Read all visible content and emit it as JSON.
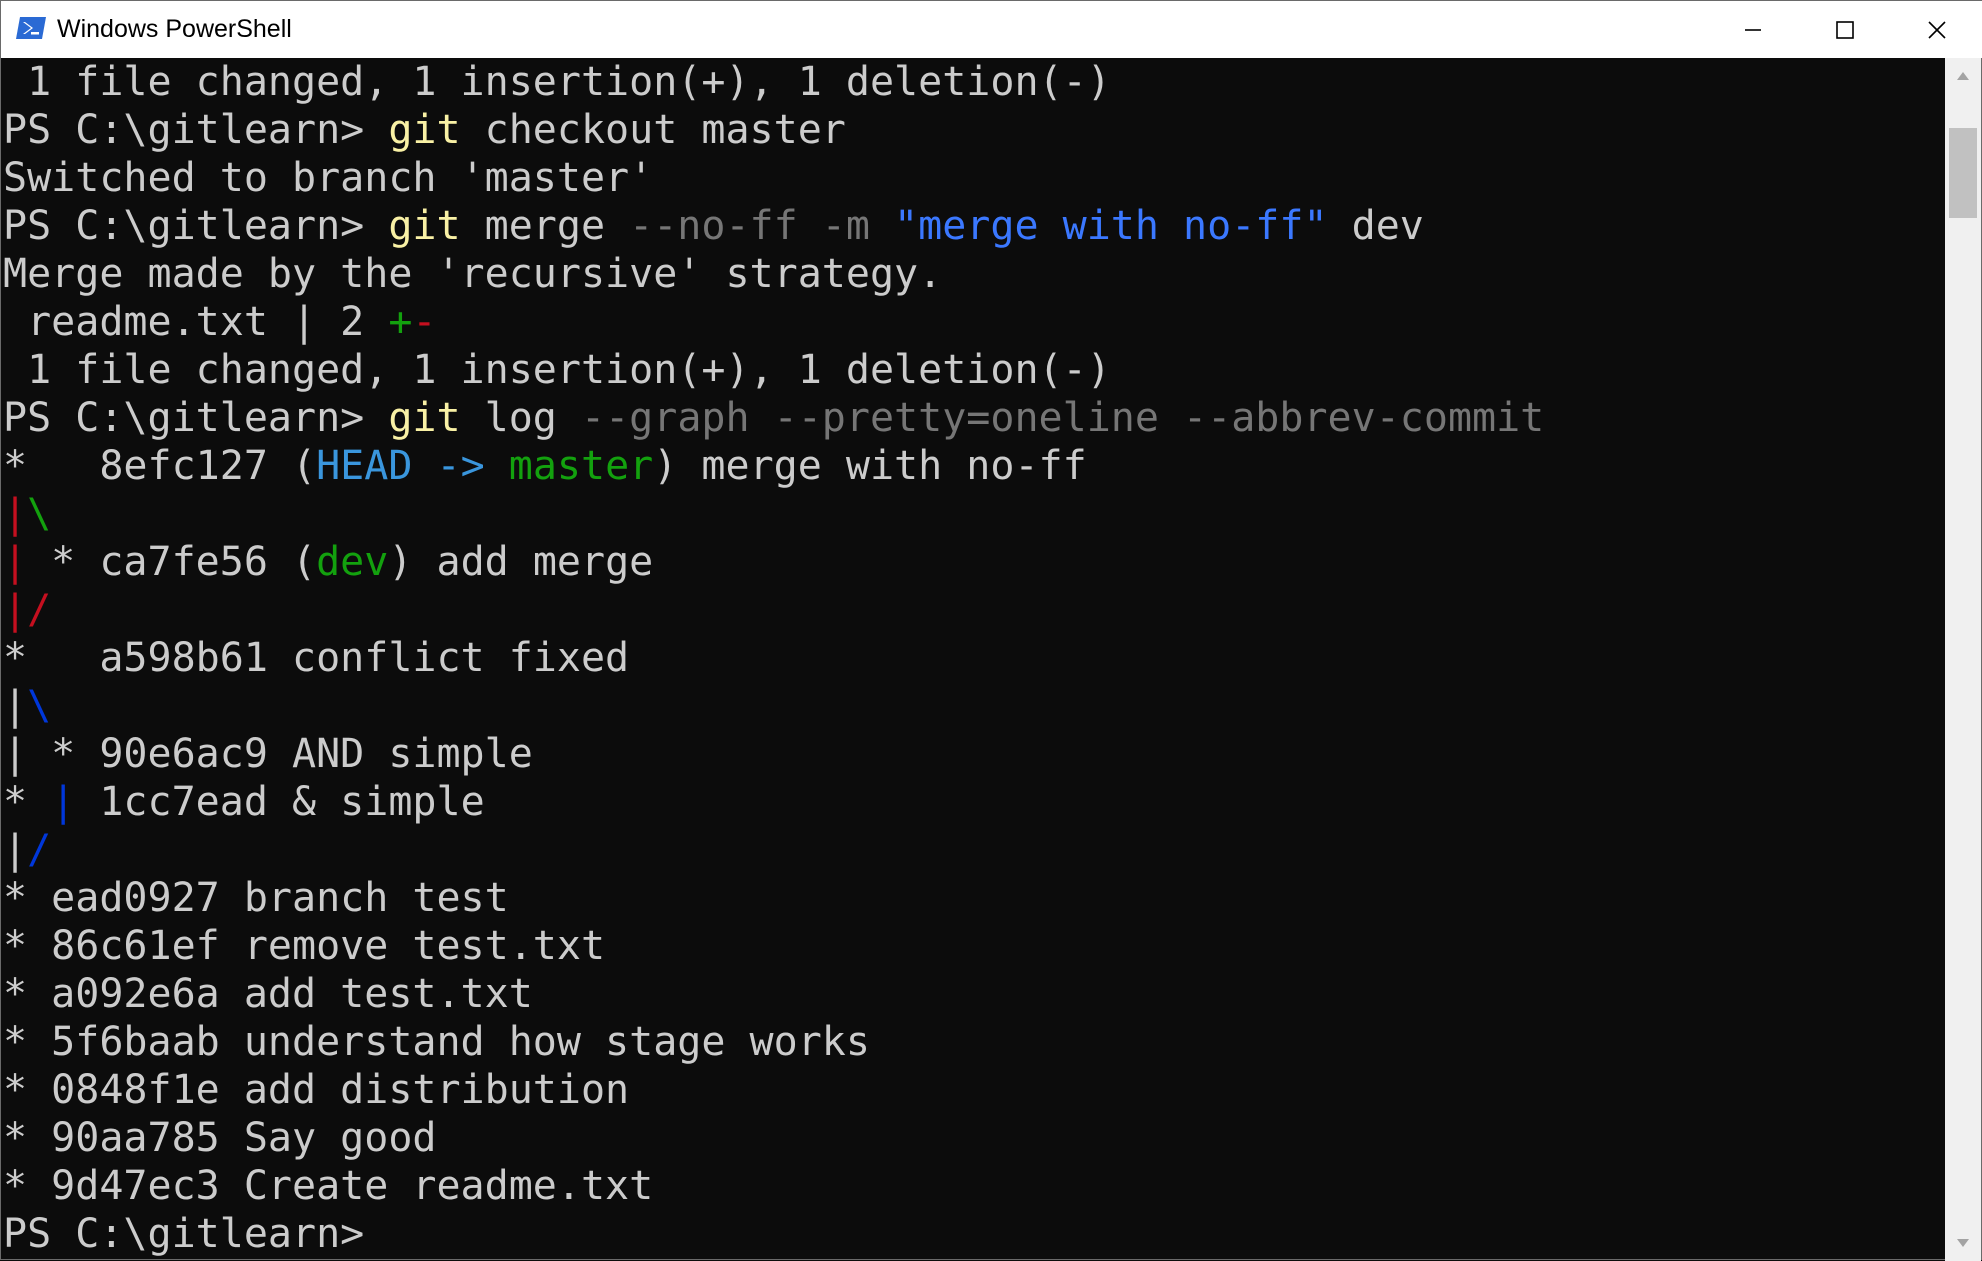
{
  "window": {
    "title": "Windows PowerShell"
  },
  "colors": {
    "default": "#cccccc",
    "cmd": "#f9f1a5",
    "param": "#767676",
    "string": "#3b78ff",
    "green": "#13a10e",
    "cyan": "#3a96dd",
    "red": "#c50f1f",
    "blue": "#0037da"
  },
  "lines": [
    [
      {
        "t": " 1 file changed, 1 insertion(+), 1 deletion(-)",
        "c": "default"
      }
    ],
    [
      {
        "t": "PS C:\\gitlearn> ",
        "c": "default"
      },
      {
        "t": "git",
        "c": "cmd"
      },
      {
        "t": " checkout master",
        "c": "default"
      }
    ],
    [
      {
        "t": "Switched to branch 'master'",
        "c": "default"
      }
    ],
    [
      {
        "t": "PS C:\\gitlearn> ",
        "c": "default"
      },
      {
        "t": "git",
        "c": "cmd"
      },
      {
        "t": " merge ",
        "c": "default"
      },
      {
        "t": "--no-ff -m ",
        "c": "param"
      },
      {
        "t": "\"merge with no-ff\"",
        "c": "string"
      },
      {
        "t": " dev",
        "c": "default"
      }
    ],
    [
      {
        "t": "Merge made by the 'recursive' strategy.",
        "c": "default"
      }
    ],
    [
      {
        "t": " readme.txt | 2 ",
        "c": "default"
      },
      {
        "t": "+",
        "c": "green"
      },
      {
        "t": "-",
        "c": "red"
      }
    ],
    [
      {
        "t": " 1 file changed, 1 insertion(+), 1 deletion(-)",
        "c": "default"
      }
    ],
    [
      {
        "t": "PS C:\\gitlearn> ",
        "c": "default"
      },
      {
        "t": "git",
        "c": "cmd"
      },
      {
        "t": " log ",
        "c": "default"
      },
      {
        "t": "--graph --pretty=oneline --abbrev-commit",
        "c": "param"
      }
    ],
    [
      {
        "t": "*   8efc127 (",
        "c": "default"
      },
      {
        "t": "HEAD -> ",
        "c": "cyan"
      },
      {
        "t": "master",
        "c": "green"
      },
      {
        "t": ") merge with no-ff",
        "c": "default"
      }
    ],
    [
      {
        "t": "|",
        "c": "red"
      },
      {
        "t": "\\",
        "c": "green"
      }
    ],
    [
      {
        "t": "|",
        "c": "red"
      },
      {
        "t": " * ca7fe56 (",
        "c": "default"
      },
      {
        "t": "dev",
        "c": "green"
      },
      {
        "t": ") add merge",
        "c": "default"
      }
    ],
    [
      {
        "t": "|",
        "c": "red"
      },
      {
        "t": "/",
        "c": "red"
      }
    ],
    [
      {
        "t": "*   a598b61 conflict fixed",
        "c": "default"
      }
    ],
    [
      {
        "t": "|",
        "c": "default"
      },
      {
        "t": "\\",
        "c": "blue"
      }
    ],
    [
      {
        "t": "| * 90e6ac9 AND simple",
        "c": "default"
      }
    ],
    [
      {
        "t": "* ",
        "c": "default"
      },
      {
        "t": "|",
        "c": "blue"
      },
      {
        "t": " 1cc7ead & simple",
        "c": "default"
      }
    ],
    [
      {
        "t": "|",
        "c": "default"
      },
      {
        "t": "/",
        "c": "blue"
      }
    ],
    [
      {
        "t": "* ead0927 branch test",
        "c": "default"
      }
    ],
    [
      {
        "t": "* 86c61ef remove test.txt",
        "c": "default"
      }
    ],
    [
      {
        "t": "* a092e6a add test.txt",
        "c": "default"
      }
    ],
    [
      {
        "t": "* 5f6baab understand how stage works",
        "c": "default"
      }
    ],
    [
      {
        "t": "* 0848f1e add distribution",
        "c": "default"
      }
    ],
    [
      {
        "t": "* 90aa785 Say good",
        "c": "default"
      }
    ],
    [
      {
        "t": "* 9d47ec3 Create readme.txt",
        "c": "default"
      }
    ],
    [
      {
        "t": "PS C:\\gitlearn>",
        "c": "default"
      }
    ]
  ]
}
